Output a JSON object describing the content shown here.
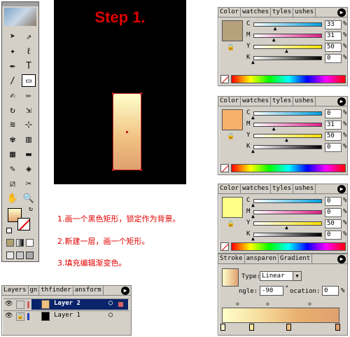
{
  "artboard": {
    "step_title": "Step 1."
  },
  "instructions": [
    "1.画一个黑色矩形，锁定作为背景。",
    "2.新建一层，画一个矩形。",
    "3.填充编辑渐变色。"
  ],
  "toolbox": {
    "tools": [
      "selection",
      "direct-selection",
      "magic-wand",
      "lasso",
      "pen",
      "type",
      "line",
      "rectangle",
      "paintbrush",
      "pencil",
      "rotate",
      "scale",
      "warp",
      "free-transform",
      "symbol-sprayer",
      "graph",
      "mesh",
      "gradient",
      "eyedropper",
      "blend",
      "slice",
      "scissors",
      "hand",
      "zoom"
    ]
  },
  "color_panels": [
    {
      "tabs": [
        "Color",
        "watches",
        "tyles",
        "ushes"
      ],
      "swatch": "#b5a27c",
      "values": {
        "C": "33",
        "M": "31",
        "Y": "50",
        "K": "0"
      },
      "markers": [
        0.33,
        0.31,
        0.5,
        0.0
      ]
    },
    {
      "tabs": [
        "Color",
        "watches",
        "tyles",
        "ushes"
      ],
      "swatch": "#f7b06a",
      "values": {
        "C": "0",
        "M": "31",
        "Y": "50",
        "K": "0"
      },
      "markers": [
        0.0,
        0.31,
        0.5,
        0.0
      ]
    },
    {
      "tabs": [
        "Color",
        "watches",
        "tyles",
        "ushes"
      ],
      "swatch": "#ffff88",
      "values": {
        "C": "0",
        "M": "0",
        "Y": "50",
        "K": "0"
      },
      "markers": [
        0.0,
        0.0,
        0.5,
        0.0
      ]
    }
  ],
  "percent_symbol": "%",
  "gradient_panel": {
    "tabs": [
      "Stroke",
      "ansparen",
      "Gradient"
    ],
    "type_label": "Type:",
    "type_value": "Linear",
    "angle_label": "ngle:",
    "angle_value": "-90",
    "location_label": "ocation:",
    "location_value": "0"
  },
  "layers_panel": {
    "tabs": [
      "Layers",
      "gn",
      "thfinder",
      "ansform"
    ],
    "layers": [
      {
        "name": "Layer 2",
        "selected": true,
        "thumb": "#f0c080",
        "color": "#d06060"
      },
      {
        "name": "Layer 1",
        "selected": false,
        "thumb": "#000000",
        "color": "#2040c0"
      }
    ]
  }
}
